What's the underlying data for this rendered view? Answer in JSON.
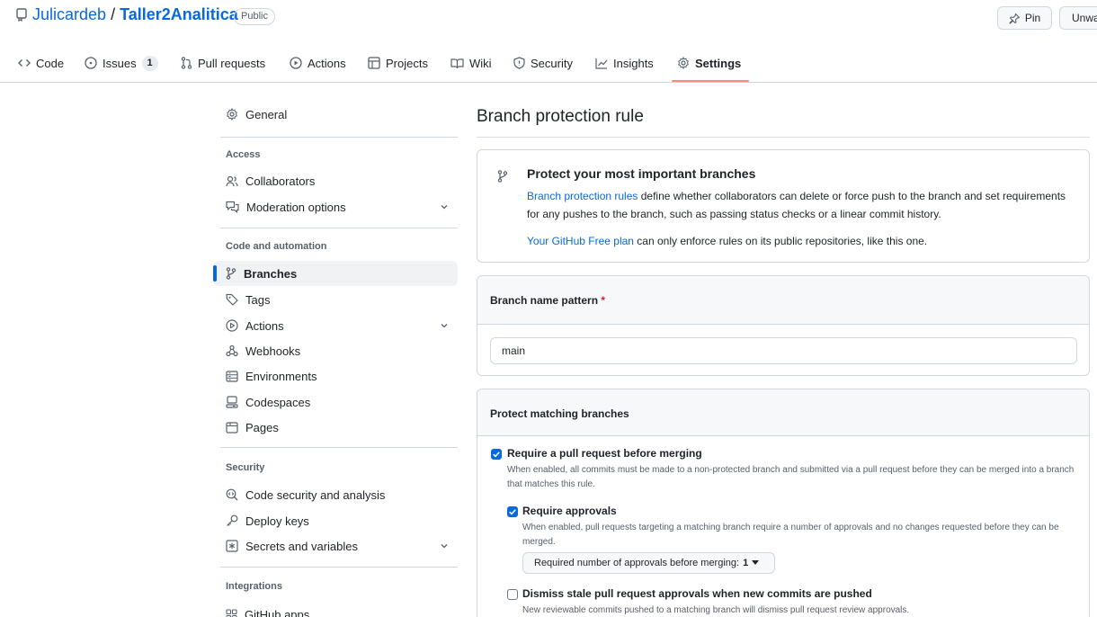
{
  "header": {
    "owner": "Julicardeb",
    "separator": "/",
    "repo": "Taller2Analitica",
    "visibility": "Public",
    "pin_label": "Pin",
    "watch_label": "Unwatch"
  },
  "nav": {
    "tabs": [
      {
        "label": "Code",
        "icon": "code-icon"
      },
      {
        "label": "Issues",
        "icon": "issue-icon",
        "count": "1"
      },
      {
        "label": "Pull requests",
        "icon": "pull-request-icon"
      },
      {
        "label": "Actions",
        "icon": "play-icon"
      },
      {
        "label": "Projects",
        "icon": "table-icon"
      },
      {
        "label": "Wiki",
        "icon": "book-icon"
      },
      {
        "label": "Security",
        "icon": "shield-icon"
      },
      {
        "label": "Insights",
        "icon": "graph-icon"
      },
      {
        "label": "Settings",
        "icon": "gear-icon",
        "active": true
      }
    ],
    "accent_color": "#fd8c73"
  },
  "sidebar": {
    "general": "General",
    "access_heading": "Access",
    "access_items": [
      "Collaborators",
      "Moderation options"
    ],
    "code_heading": "Code and automation",
    "code_items": [
      "Branches",
      "Tags",
      "Actions",
      "Webhooks",
      "Environments",
      "Codespaces",
      "Pages"
    ],
    "security_heading": "Security",
    "security_items": [
      "Code security and analysis",
      "Deploy keys",
      "Secrets and variables"
    ],
    "integrations_heading": "Integrations",
    "integrations_items": [
      "GitHub apps"
    ],
    "selected": "Branches",
    "selected_color": "#0969da"
  },
  "main": {
    "title": "Branch protection rule",
    "info": {
      "title": "Protect your most important branches",
      "link": "Branch protection rules",
      "body": " define whether collaborators can delete or force push to the branch and set requirements for any pushes to the branch, such as passing status checks or a linear commit history.",
      "plan_link": "Your GitHub Free plan",
      "plan_text": " can only enforce rules on its public repositories, like this one."
    },
    "pattern": {
      "label": "Branch name pattern",
      "required_mark": "*",
      "value": "main"
    },
    "protect": {
      "heading": "Protect matching branches",
      "options": [
        {
          "label": "Require a pull request before merging",
          "checked": true,
          "desc": "When enabled, all commits must be made to a non-protected branch and submitted via a pull request before they can be merged into a branch that matches this rule."
        },
        {
          "label": "Require approvals",
          "checked": true,
          "desc": "When enabled, pull requests targeting a matching branch require a number of approvals and no changes requested before they can be merged."
        },
        {
          "label": "Dismiss stale pull request approvals when new commits are pushed",
          "checked": false,
          "desc": "New reviewable commits pushed to a matching branch will dismiss pull request review approvals."
        }
      ],
      "approvals_select_label": "Required number of approvals before merging:",
      "approvals_value": "1"
    }
  }
}
